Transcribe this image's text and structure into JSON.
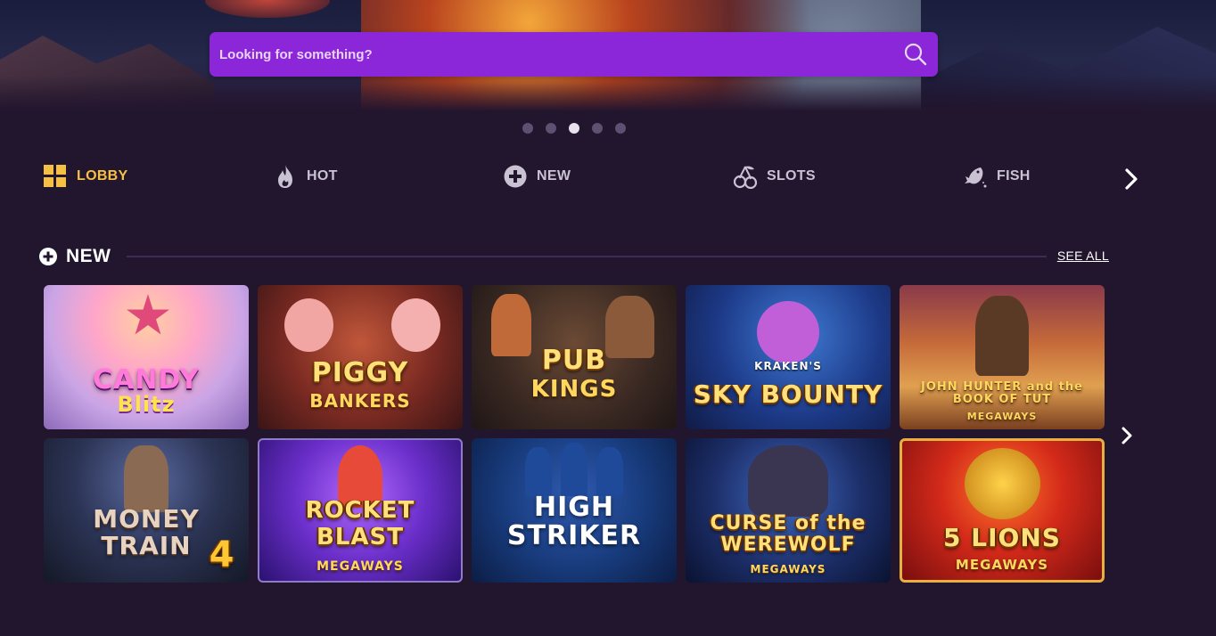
{
  "search": {
    "placeholder": "Looking for something?"
  },
  "carousel": {
    "dot_count": 5,
    "active_index": 2
  },
  "categories": [
    {
      "label": "LOBBY",
      "icon": "grid-icon",
      "active": true
    },
    {
      "label": "HOT",
      "icon": "flame-icon",
      "active": false
    },
    {
      "label": "NEW",
      "icon": "plus-circle-icon",
      "active": false
    },
    {
      "label": "SLOTS",
      "icon": "cherries-icon",
      "active": false
    },
    {
      "label": "FISH",
      "icon": "fish-icon",
      "active": false
    }
  ],
  "section": {
    "title": "NEW",
    "see_all": "SEE ALL"
  },
  "games": [
    {
      "title": "CANDY",
      "subtitle": "Blitz"
    },
    {
      "title": "PIGGY",
      "subtitle": "BANKERS"
    },
    {
      "title": "PUB",
      "subtitle": "KINGS"
    },
    {
      "title": "KRAKEN'S",
      "subtitle": "SKY BOUNTY"
    },
    {
      "title": "JOHN HUNTER and the BOOK OF TUT",
      "subtitle": "MEGAWAYS"
    },
    {
      "title": "MONEY TRAIN",
      "subtitle": "4"
    },
    {
      "title": "ROCKET BLAST",
      "subtitle": "MEGAWAYS"
    },
    {
      "title": "HIGH STRIKER",
      "subtitle": ""
    },
    {
      "title": "CURSE of the WEREWOLF",
      "subtitle": "MEGAWAYS"
    },
    {
      "title": "5 LIONS",
      "subtitle": "MEGAWAYS"
    }
  ],
  "colors": {
    "accent": "#8b26d9",
    "active_category": "#f5c043",
    "background": "#22152e"
  }
}
